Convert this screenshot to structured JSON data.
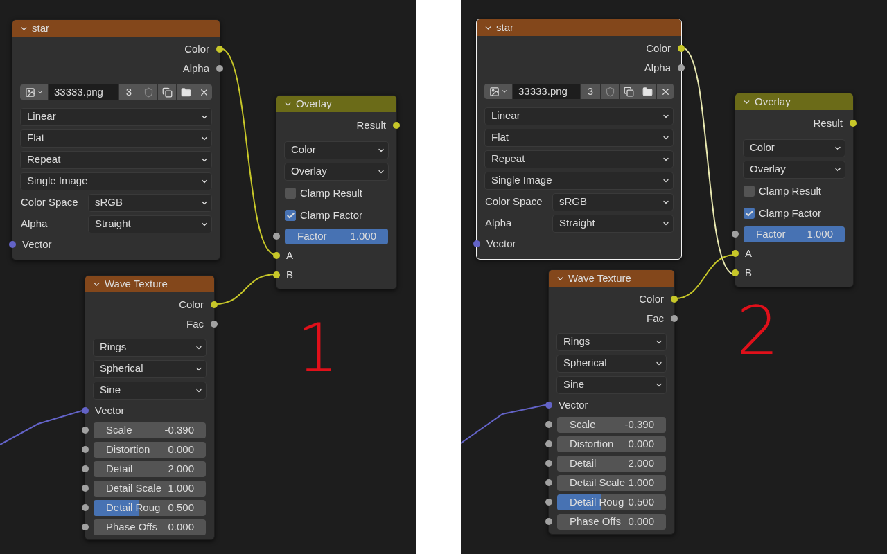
{
  "panels": [
    {
      "annotation": "1",
      "nodes": [
        {
          "kind": "image_texture",
          "title": "star",
          "selected": false,
          "outputs": [
            {
              "label": "Color",
              "kind": "color"
            },
            {
              "label": "Alpha",
              "kind": "float"
            }
          ],
          "image": {
            "name": "33333.png",
            "users": "3"
          },
          "dropdowns": [
            "Linear",
            "Flat",
            "Repeat",
            "Single Image"
          ],
          "properties": [
            {
              "label": "Color Space",
              "value": "sRGB"
            },
            {
              "label": "Alpha",
              "value": "Straight"
            }
          ],
          "inputs": [
            {
              "label": "Vector",
              "kind": "vector"
            }
          ]
        },
        {
          "kind": "mix",
          "title": "Overlay",
          "selected": false,
          "outputs": [
            {
              "label": "Result",
              "kind": "color"
            }
          ],
          "dropdowns": [
            "Color",
            "Overlay"
          ],
          "checkboxes": [
            {
              "label": "Clamp Result",
              "checked": false
            },
            {
              "label": "Clamp Factor",
              "checked": true
            }
          ],
          "fields": [
            {
              "label": "Factor",
              "value": "1.000",
              "level": 1
            }
          ],
          "inputs": [
            {
              "label": "A",
              "kind": "color"
            },
            {
              "label": "B",
              "kind": "color"
            }
          ]
        },
        {
          "kind": "wave_texture",
          "title": "Wave Texture",
          "selected": false,
          "outputs": [
            {
              "label": "Color",
              "kind": "color"
            },
            {
              "label": "Fac",
              "kind": "float"
            }
          ],
          "dropdowns": [
            "Rings",
            "Spherical",
            "Sine"
          ],
          "inputs": [
            {
              "label": "Vector",
              "kind": "vector"
            }
          ],
          "fields": [
            {
              "label": "Scale",
              "value": "-0.390"
            },
            {
              "label": "Distortion",
              "value": "0.000"
            },
            {
              "label": "Detail",
              "value": "2.000"
            },
            {
              "label": "Detail Scale",
              "value": "1.000"
            },
            {
              "label": "Detail Roug",
              "value": "0.500",
              "level": 0.4
            },
            {
              "label": "Phase Offs",
              "value": "0.000"
            }
          ]
        }
      ]
    },
    {
      "annotation": "2",
      "nodes": [
        {
          "kind": "image_texture",
          "title": "star",
          "selected": true,
          "outputs": [
            {
              "label": "Color",
              "kind": "color"
            },
            {
              "label": "Alpha",
              "kind": "float"
            }
          ],
          "image": {
            "name": "33333.png",
            "users": "3"
          },
          "dropdowns": [
            "Linear",
            "Flat",
            "Repeat",
            "Single Image"
          ],
          "properties": [
            {
              "label": "Color Space",
              "value": "sRGB"
            },
            {
              "label": "Alpha",
              "value": "Straight"
            }
          ],
          "inputs": [
            {
              "label": "Vector",
              "kind": "vector"
            }
          ]
        },
        {
          "kind": "mix",
          "title": "Overlay",
          "selected": false,
          "outputs": [
            {
              "label": "Result",
              "kind": "color"
            }
          ],
          "dropdowns": [
            "Color",
            "Overlay"
          ],
          "checkboxes": [
            {
              "label": "Clamp Result",
              "checked": false
            },
            {
              "label": "Clamp Factor",
              "checked": true
            }
          ],
          "fields": [
            {
              "label": "Factor",
              "value": "1.000",
              "level": 1
            }
          ],
          "inputs": [
            {
              "label": "A",
              "kind": "color"
            },
            {
              "label": "B",
              "kind": "color"
            }
          ]
        },
        {
          "kind": "wave_texture",
          "title": "Wave Texture",
          "selected": false,
          "outputs": [
            {
              "label": "Color",
              "kind": "color"
            },
            {
              "label": "Fac",
              "kind": "float"
            }
          ],
          "dropdowns": [
            "Rings",
            "Spherical",
            "Sine"
          ],
          "inputs": [
            {
              "label": "Vector",
              "kind": "vector"
            }
          ],
          "fields": [
            {
              "label": "Scale",
              "value": "-0.390"
            },
            {
              "label": "Distortion",
              "value": "0.000"
            },
            {
              "label": "Detail",
              "value": "2.000"
            },
            {
              "label": "Detail Scale",
              "value": "1.000"
            },
            {
              "label": "Detail Roug",
              "value": "0.500",
              "level": 0.4
            },
            {
              "label": "Phase Offs",
              "value": "0.000"
            }
          ]
        }
      ]
    }
  ]
}
